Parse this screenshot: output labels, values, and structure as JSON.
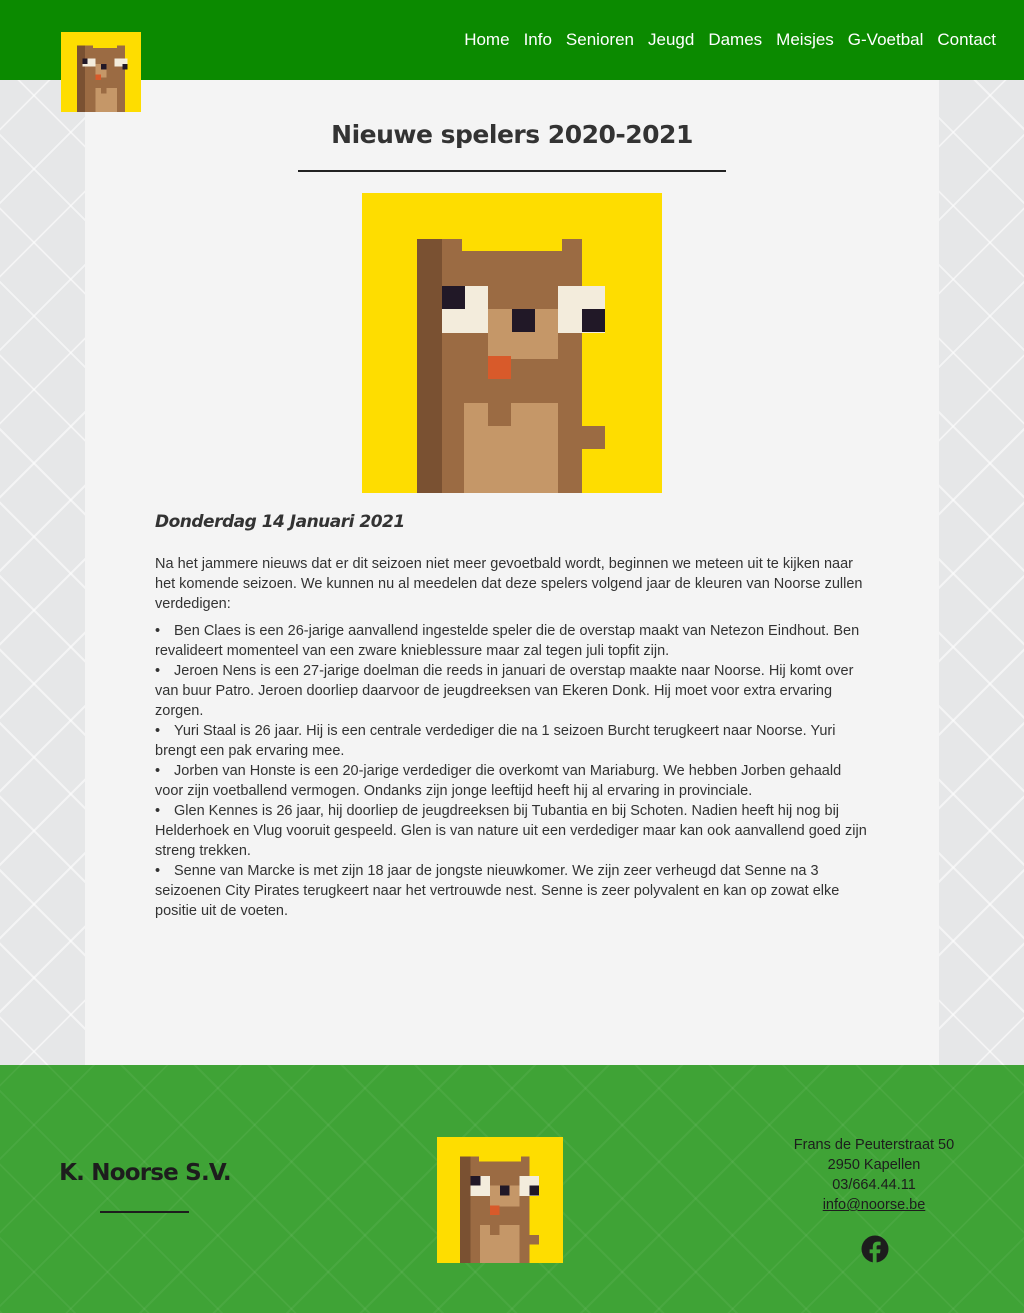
{
  "nav": {
    "logo_icon": "k-noorse-sv-pixel-logo",
    "links": [
      "Home",
      "Info",
      "Senioren",
      "Jeugd",
      "Dames",
      "Meisjes",
      "G-Voetbal",
      "Contact"
    ]
  },
  "article": {
    "title": "Nieuwe spelers 2020-2021",
    "hero_icon": "k-noorse-sv-pixel-logo",
    "date": "Donderdag 14 Januari 2021",
    "intro": "Na het jammere nieuws dat er dit seizoen niet meer gevoetbald wordt, beginnen we meteen uit te kijken naar het komende seizoen. We kunnen nu al meedelen dat deze spelers volgend jaar de kleuren van Noorse zullen verdedigen:",
    "bullet": "•",
    "players": [
      "Ben Claes is een 26-jarige aanvallend ingestelde speler die de overstap maakt van Netezon Eindhout. Ben revalideert momenteel van een zware knieblessure maar zal tegen juli topfit zijn.",
      "Jeroen Nens is een 27-jarige doelman die reeds in januari de overstap maakte naar Noorse. Hij komt over van buur Patro. Jeroen doorliep daarvoor de jeugdreeksen van Ekeren Donk. Hij moet voor extra ervaring zorgen.",
      "Yuri Staal is 26 jaar. Hij is een centrale verdediger die na 1 seizoen Burcht terugkeert naar Noorse. Yuri brengt een pak ervaring mee.",
      "Jorben van Honste is een 20-jarige verdediger die overkomt van Mariaburg. We hebben Jorben gehaald voor zijn voetballend vermogen. Ondanks zijn jonge leeftijd heeft hij al ervaring in provinciale.",
      "Glen Kennes is 26 jaar, hij doorliep de jeugdreeksen bij Tubantia en bij Schoten. Nadien heeft hij nog bij Helderhoek en Vlug vooruit gespeeld. Glen is van nature uit een verdediger maar kan ook aanvallend goed zijn streng trekken.",
      "Senne van Marcke is met zijn 18 jaar de jongste nieuwkomer. We zijn zeer verheugd dat Senne na 3 seizoenen City Pirates terugkeert naar het vertrouwde nest. Senne is zeer polyvalent en kan op zowat elke positie uit de voeten."
    ]
  },
  "footer": {
    "club_name": "K. Noorse S.V.",
    "logo_icon": "k-noorse-sv-pixel-logo",
    "street": "Frans de Peuterstraat 50",
    "city": "2950 Kapellen",
    "phone": "03/664.44.11",
    "email": "info@noorse.be",
    "social_icon": "facebook-icon"
  },
  "colors": {
    "navbar": "#0b8a00",
    "footer": "#3fa336",
    "logo_yellow": "#fedd00",
    "logo_brown": "#9b6b43"
  }
}
